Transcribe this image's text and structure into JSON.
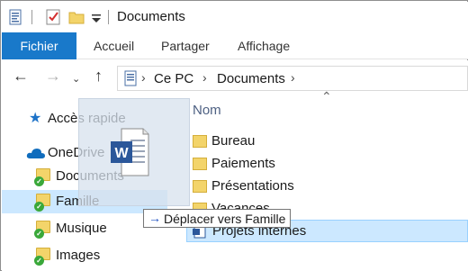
{
  "window": {
    "title": "Documents"
  },
  "ribbon": {
    "tabs": [
      {
        "label": "Fichier"
      },
      {
        "label": "Accueil"
      },
      {
        "label": "Partager"
      },
      {
        "label": "Affichage"
      }
    ]
  },
  "address_bar": {
    "path": [
      "Ce PC",
      "Documents"
    ]
  },
  "nav_pane": {
    "items": [
      {
        "label": "Accès rapide"
      },
      {
        "label": "OneDrive"
      },
      {
        "label": "Documents"
      },
      {
        "label": "Famille"
      },
      {
        "label": "Musique"
      },
      {
        "label": "Images"
      }
    ]
  },
  "content": {
    "column_header": "Nom",
    "files": [
      {
        "label": "Bureau"
      },
      {
        "label": "Paiements"
      },
      {
        "label": "Présentations"
      },
      {
        "label": "Vacances"
      },
      {
        "label": "Projets internes"
      }
    ]
  },
  "drag": {
    "tooltip": "Déplacer vers Famille",
    "icon": "word-document-icon"
  },
  "colors": {
    "file_tab": "#1979ca",
    "selection": "#cce8ff",
    "word_blue": "#2b579a",
    "folder": "#f3d46a"
  }
}
